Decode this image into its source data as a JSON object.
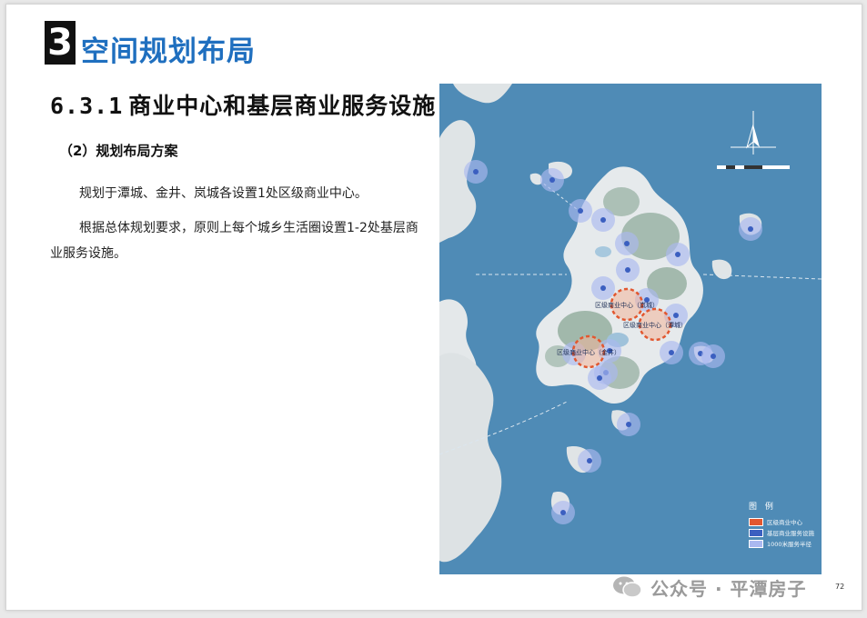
{
  "section": {
    "number": "3",
    "title": "空间规划布局"
  },
  "heading": {
    "number": "6.3.1",
    "text": "商业中心和基层商业服务设施"
  },
  "subheading": "（2）规划布局方案",
  "paragraphs": [
    "规划于潭城、金井、岚城各设置1处区级商业中心。",
    "根据总体规划要求，原则上每个城乡生活圈设置1-2处基层商业服务设施。"
  ],
  "map": {
    "district_centers": [
      "区级商业中心（岚城）",
      "区级商业中心（潭城）",
      "区级商业中心（金井）"
    ],
    "legend": {
      "title": "图 例",
      "items": [
        "区级商业中心",
        "基层商业服务设施",
        "1000米服务半径"
      ]
    },
    "colors": {
      "sea": "#4f8bb6",
      "land": "#e3e8ea",
      "green": "#7f9f8f",
      "service": "#3b5fc0",
      "center": "#e2572f"
    }
  },
  "page_number": "72",
  "watermark": "公众号 · 平潭房子"
}
